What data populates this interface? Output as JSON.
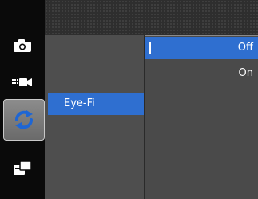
{
  "menu": {
    "setting_label": "Eye-Fi",
    "options": [
      {
        "label": "Off",
        "selected": true
      },
      {
        "label": "On",
        "selected": false
      }
    ]
  },
  "sidebar": {
    "icons": [
      "camera-icon",
      "movie-icon",
      "settings-refresh-icon",
      "playback-icon"
    ],
    "active_index": 2
  },
  "colors": {
    "highlight": "#2f6fd0",
    "sidebar": "#0a0a0a",
    "panel": "#4e4e4e"
  }
}
